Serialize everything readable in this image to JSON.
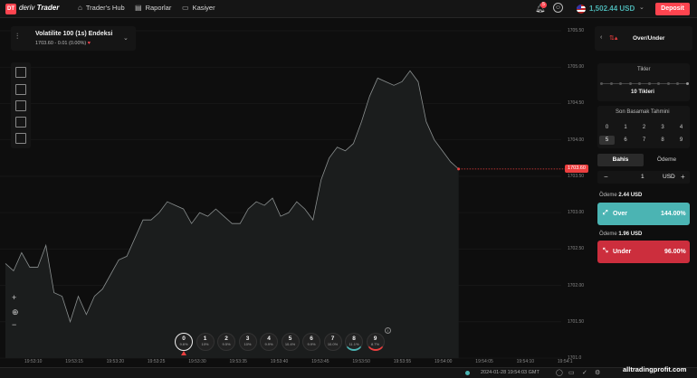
{
  "header": {
    "logo_badge": "DT",
    "logo_brand": "deriv",
    "logo_product": "Trader",
    "nav": [
      {
        "label": "Trader's Hub",
        "icon": "home-icon"
      },
      {
        "label": "Raporlar",
        "icon": "reports-icon"
      },
      {
        "label": "Kasiyer",
        "icon": "cashier-icon"
      }
    ],
    "notification_count": "5",
    "balance": "1,502.44 USD",
    "deposit_label": "Deposit"
  },
  "market": {
    "name": "Volatilite 100 (1s) Endeksi",
    "value": "1703.60 - 0.01 (0.00%)"
  },
  "chart_data": {
    "type": "line",
    "ylim": [
      1701.0,
      1705.6
    ],
    "y_ticks": [
      "1705.50",
      "1705.00",
      "1704.50",
      "1704.00",
      "1703.50",
      "1703.00",
      "1702.50",
      "1702.00",
      "1701.50",
      "1701.0"
    ],
    "x_ticks": [
      "19:53:10",
      "19:53:15",
      "19:53:20",
      "19:53:25",
      "19:53:30",
      "19:53:35",
      "19:53:40",
      "19:53:45",
      "19:53:50",
      "19:53:55",
      "19:54:00",
      "19:54:05",
      "19:54:10",
      "19:54:1"
    ],
    "x_seconds": [
      0,
      1,
      2,
      3,
      4,
      5,
      6,
      7,
      8,
      9,
      10,
      11,
      12,
      13,
      14,
      15,
      16,
      17,
      18,
      19,
      20,
      21,
      22,
      23,
      24,
      25,
      26,
      27,
      28,
      29,
      30,
      31,
      32,
      33,
      34,
      35,
      36,
      37,
      38,
      39,
      40,
      41,
      42,
      43,
      44,
      45,
      46,
      47,
      48,
      49,
      50,
      51,
      52,
      53,
      54,
      55,
      56
    ],
    "values": [
      1702.3,
      1702.2,
      1702.45,
      1702.25,
      1702.25,
      1702.55,
      1701.9,
      1701.85,
      1701.5,
      1701.85,
      1701.6,
      1701.85,
      1701.95,
      1702.15,
      1702.35,
      1702.4,
      1702.65,
      1702.9,
      1702.9,
      1703.0,
      1703.15,
      1703.1,
      1703.05,
      1702.85,
      1703.0,
      1702.95,
      1703.05,
      1702.95,
      1702.85,
      1702.85,
      1703.05,
      1703.15,
      1703.1,
      1703.2,
      1702.95,
      1703.0,
      1703.15,
      1703.05,
      1702.9,
      1703.45,
      1703.75,
      1703.9,
      1703.85,
      1703.95,
      1704.25,
      1704.6,
      1704.85,
      1704.8,
      1704.75,
      1704.8,
      1704.95,
      1704.8,
      1704.25,
      1704.0,
      1703.85,
      1703.7,
      1703.6
    ],
    "current_price": "1703.60"
  },
  "digits": [
    {
      "d": "0",
      "p": "9.6%"
    },
    {
      "d": "1",
      "p": "10%"
    },
    {
      "d": "2",
      "p": "9.5%"
    },
    {
      "d": "3",
      "p": "10%"
    },
    {
      "d": "4",
      "p": "9.9%"
    },
    {
      "d": "5",
      "p": "10.4%"
    },
    {
      "d": "6",
      "p": "9.9%"
    },
    {
      "d": "7",
      "p": "10.0%"
    },
    {
      "d": "8",
      "p": "11.1%"
    },
    {
      "d": "9",
      "p": "8.7%"
    }
  ],
  "trade": {
    "type_name": "Over/Under",
    "ticks_label": "Tikler",
    "ticks_value": "10 Tikleri",
    "digit_label": "Son Basamak Tahmini",
    "digit_options": [
      "0",
      "1",
      "2",
      "3",
      "4",
      "5",
      "6",
      "7",
      "8",
      "9"
    ],
    "selected_digit": "5",
    "tab_stake": "Bahis",
    "tab_payout": "Ödeme",
    "stake_minus": "−",
    "stake_value": "1",
    "stake_currency": "USD",
    "stake_plus": "+",
    "payout_label_1": "Ödeme",
    "payout_over": "2.44 USD",
    "over_label": "Over",
    "over_pct": "144.00%",
    "payout_label_2": "Ödeme",
    "payout_under": "1.96 USD",
    "under_label": "Under",
    "under_pct": "96.00%"
  },
  "footer": {
    "datetime": "2024-01-28 19:54:03 GMT"
  },
  "watermark": "alltradingprofit.com",
  "colors": {
    "accent_red": "#ff444f",
    "over_teal": "#4bb4b3",
    "under_red": "#cc2e3d"
  }
}
